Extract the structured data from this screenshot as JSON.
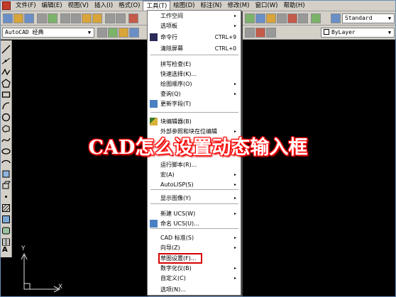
{
  "menubar": {
    "items": [
      "文件(F)",
      "编辑(E)",
      "视图(V)",
      "插入(I)",
      "格式(O)",
      "工具(T)",
      "绘图(D)",
      "标注(N)",
      "修改(M)",
      "窗口(W)",
      "帮助(H)"
    ],
    "active_index": 5
  },
  "toolbar": {
    "workspace_combo": "AutoCAD 经典",
    "style_combo": "Standard",
    "layer_combo": "ByLayer"
  },
  "tools_menu": {
    "items": [
      {
        "label": "工作空间",
        "arrow": "▸"
      },
      {
        "label": "选项板",
        "arrow": "▸"
      },
      {
        "label": "命令行",
        "shortcut": "CTRL+9"
      },
      {
        "label": "清除屏幕",
        "shortcut": "CTRL+0"
      },
      {
        "label": "拼写检查(E)"
      },
      {
        "label": "快速选择(K)..."
      },
      {
        "label": "绘图顺序(O)",
        "arrow": "▸"
      },
      {
        "label": "查询(Q)",
        "arrow": "▸"
      },
      {
        "label": "更新字段(T)"
      },
      {
        "label": "块编辑器(B)"
      },
      {
        "label": "外部参照和块在位编辑",
        "arrow": "▸"
      },
      {
        "label": "运行脚本(R)..."
      },
      {
        "label": "宏(A)",
        "arrow": "▸"
      },
      {
        "label": "AutoLISP(S)",
        "arrow": "▸"
      },
      {
        "label": "显示图像(Y)",
        "arrow": "▸"
      },
      {
        "label": "新建 UCS(W)",
        "arrow": "▸"
      },
      {
        "label": "命名 UCS(U)..."
      },
      {
        "label": "CAD 标准(S)",
        "arrow": "▸"
      },
      {
        "label": "向导(Z)",
        "arrow": "▸"
      },
      {
        "label": "草图设置(F)..."
      },
      {
        "label": "数字化仪(B)",
        "arrow": "▸"
      },
      {
        "label": "自定义(C)",
        "arrow": "▸"
      },
      {
        "label": "选项(N)..."
      }
    ]
  },
  "overlay_title": "CAD怎么设置动态输入框",
  "ucs": {
    "x_label": "X",
    "y_label": "Y"
  },
  "colors": {
    "highlight": "#d60000",
    "overlay_glow": "#ff0000"
  }
}
